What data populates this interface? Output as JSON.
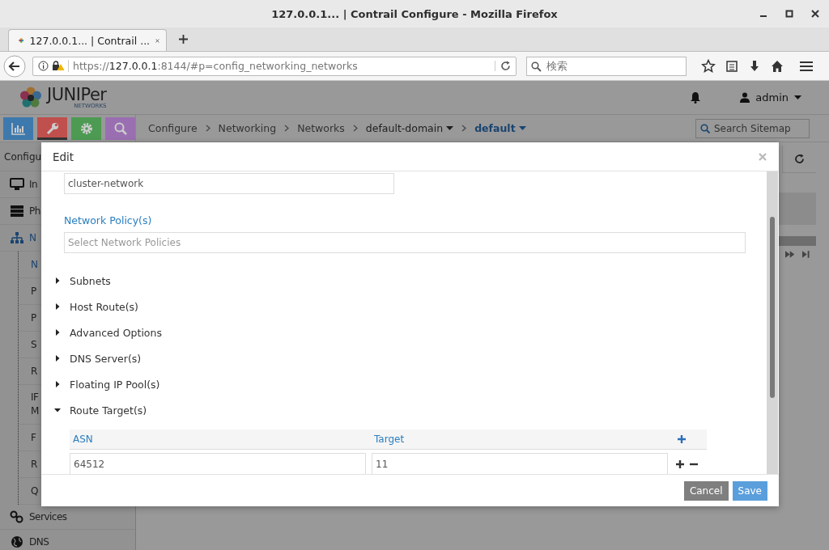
{
  "browser": {
    "title": "127.0.0.1... | Contrail Configure - Mozilla Firefox",
    "tabs": [
      {
        "label": "127.0.0.1... | Contrail ...",
        "selected": true
      }
    ],
    "url": {
      "scheme": "https://",
      "host": "127.0.0.1",
      "rest": ":8144/#p=config_networking_networks"
    },
    "search": {
      "placeholder": "検索"
    }
  },
  "app": {
    "brand": {
      "name": "JUNIPer",
      "sub": "NETWORKS"
    },
    "user": "admin",
    "nav_buttons": [
      {
        "color": "#3e79ad",
        "selected": false
      },
      {
        "color": "#c0504d",
        "selected": true
      },
      {
        "color": "#4d9a53",
        "selected": false
      },
      {
        "color": "#9a6fb1",
        "selected": false
      }
    ],
    "breadcrumb": [
      {
        "label": "Configure",
        "kind": "link"
      },
      {
        "label": "Networking",
        "kind": "link"
      },
      {
        "label": "Networks",
        "kind": "link"
      },
      {
        "label": "default-domain",
        "kind": "dropdown"
      },
      {
        "label": "default",
        "kind": "current"
      }
    ],
    "sitemap_search": {
      "placeholder": "Search Sitemap"
    },
    "sidebar": {
      "title": "Configu",
      "items": [
        {
          "label": "In",
          "selected": false
        },
        {
          "label": "Ph",
          "selected": false
        },
        {
          "label": "N",
          "selected": true,
          "expanded": true,
          "children": [
            {
              "label": "N",
              "selected": true
            },
            {
              "label": "P",
              "selected": false
            },
            {
              "label": "P",
              "selected": false
            },
            {
              "label": "S",
              "selected": false
            },
            {
              "label": "R",
              "selected": false
            },
            {
              "label": "IF M",
              "selected": false
            },
            {
              "label": "F",
              "selected": false
            },
            {
              "label": "R",
              "selected": false
            },
            {
              "label": "Q",
              "selected": false
            }
          ]
        },
        {
          "label": "Services",
          "selected": false
        },
        {
          "label": "DNS",
          "selected": false
        }
      ]
    }
  },
  "modal": {
    "title": "Edit",
    "name_value": "cluster-network",
    "policy": {
      "label": "Network Policy(s)",
      "placeholder": "Select Network Policies"
    },
    "sections": [
      {
        "label": "Subnets",
        "expanded": false
      },
      {
        "label": "Host Route(s)",
        "expanded": false
      },
      {
        "label": "Advanced Options",
        "expanded": false
      },
      {
        "label": "DNS Server(s)",
        "expanded": false
      },
      {
        "label": "Floating IP Pool(s)",
        "expanded": false
      },
      {
        "label": "Route Target(s)",
        "expanded": true
      }
    ],
    "route_targets": {
      "columns": [
        "ASN",
        "Target"
      ],
      "rows": [
        {
          "asn": "64512",
          "target": "11"
        }
      ]
    },
    "buttons": [
      {
        "label": "Cancel",
        "kind": "secondary"
      },
      {
        "label": "Save",
        "kind": "primary"
      }
    ]
  }
}
